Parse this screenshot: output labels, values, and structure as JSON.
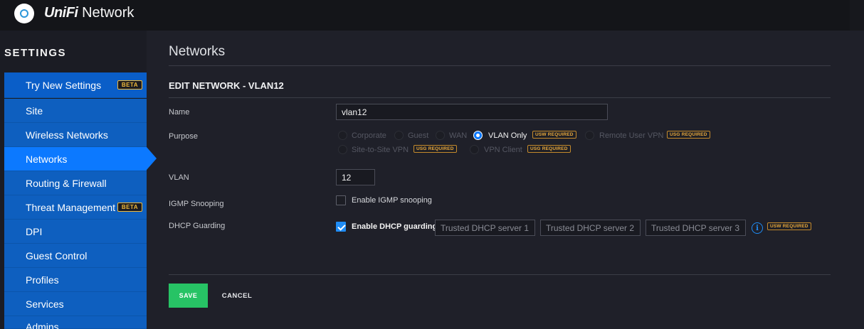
{
  "header": {
    "brand_unifi": "UniFi",
    "brand_network": "Network"
  },
  "sidebar": {
    "title": "SETTINGS",
    "items": [
      {
        "label": "Try New Settings",
        "badge": "BETA"
      },
      {
        "label": "Site"
      },
      {
        "label": "Wireless Networks"
      },
      {
        "label": "Networks",
        "active": true
      },
      {
        "label": "Routing & Firewall"
      },
      {
        "label": "Threat Management",
        "badge": "BETA"
      },
      {
        "label": "DPI"
      },
      {
        "label": "Guest Control"
      },
      {
        "label": "Profiles"
      },
      {
        "label": "Services"
      },
      {
        "label": "Admins"
      }
    ]
  },
  "main": {
    "page_title": "Networks",
    "section_title": "EDIT NETWORK - VLAN12",
    "name_label": "Name",
    "name_value": "vlan12",
    "purpose_label": "Purpose",
    "purpose_options": [
      {
        "label": "Corporate",
        "enabled": false
      },
      {
        "label": "Guest",
        "enabled": false
      },
      {
        "label": "WAN",
        "enabled": false
      },
      {
        "label": "VLAN Only",
        "enabled": true,
        "checked": true,
        "badge": "USW REQUIRED"
      },
      {
        "label": "Remote User VPN",
        "enabled": false,
        "badge": "USG REQUIRED"
      },
      {
        "label": "Site-to-Site VPN",
        "enabled": false,
        "badge": "USG REQUIRED"
      },
      {
        "label": "VPN Client",
        "enabled": false,
        "badge": "USG REQUIRED"
      }
    ],
    "vlan_label": "VLAN",
    "vlan_value": "12",
    "igmp_label": "IGMP Snooping",
    "igmp_checkbox_label": "Enable IGMP snooping",
    "igmp_checked": false,
    "dhcp_label": "DHCP Guarding",
    "dhcp_checkbox_label": "Enable DHCP guarding",
    "dhcp_checked": true,
    "dhcp_server_placeholders": [
      "Trusted DHCP server 1",
      "Trusted DHCP server 2",
      "Trusted DHCP server 3"
    ],
    "dhcp_badge": "USW REQUIRED",
    "save_label": "SAVE",
    "cancel_label": "CANCEL"
  },
  "colors": {
    "accent": "#0c79ff",
    "sidebar_item": "#0e5fbf",
    "save_green": "#27c365",
    "badge_orange": "#f0b93a"
  }
}
